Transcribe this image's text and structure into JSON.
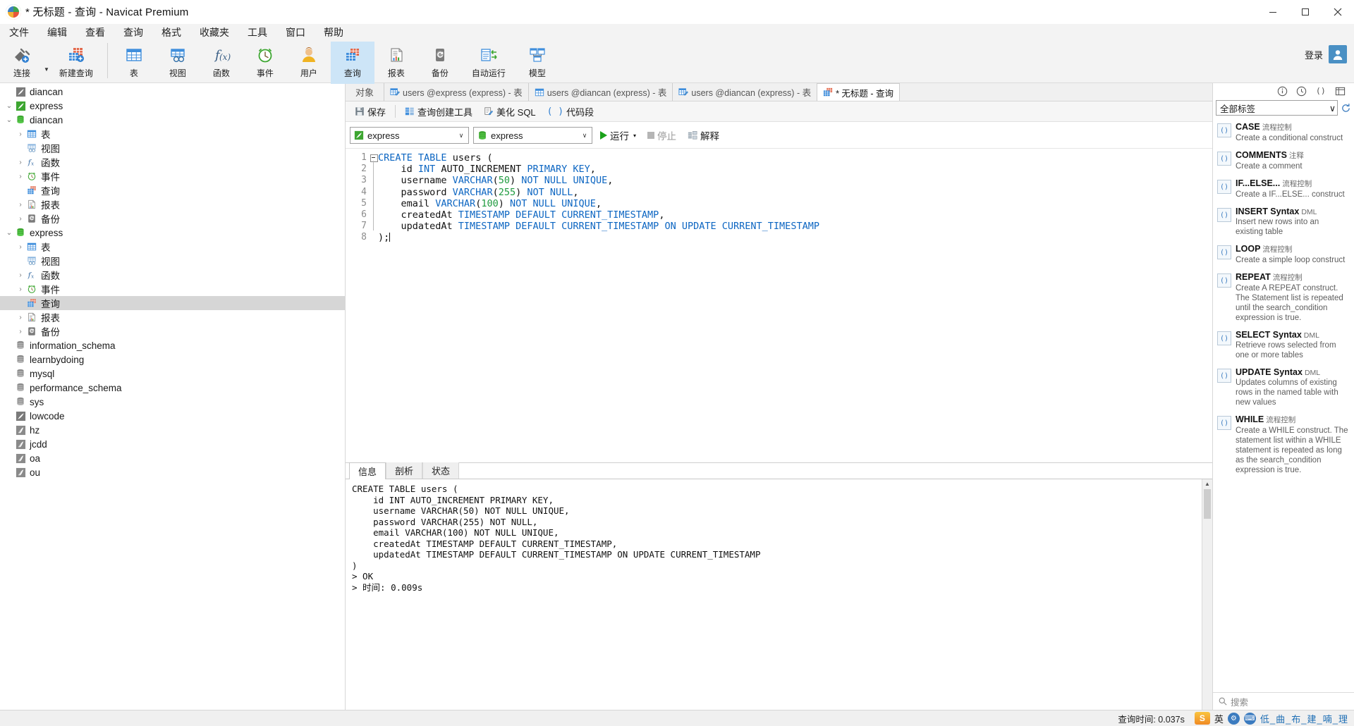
{
  "window": {
    "title": "* 无标题 - 查询 - Navicat Premium",
    "controls": {
      "minimize": "minimize-icon",
      "maximize": "maximize-icon",
      "close": "close-icon"
    }
  },
  "menubar": {
    "items": [
      {
        "label": "文件",
        "name": "menu-file"
      },
      {
        "label": "编辑",
        "name": "menu-edit"
      },
      {
        "label": "查看",
        "name": "menu-view"
      },
      {
        "label": "查询",
        "name": "menu-query"
      },
      {
        "label": "格式",
        "name": "menu-format"
      },
      {
        "label": "收藏夹",
        "name": "menu-favorites"
      },
      {
        "label": "工具",
        "name": "menu-tools"
      },
      {
        "label": "窗口",
        "name": "menu-window"
      },
      {
        "label": "帮助",
        "name": "menu-help"
      }
    ]
  },
  "ribbon": {
    "items": [
      {
        "label": "连接",
        "icon": "connection-icon"
      },
      {
        "label": "新建查询",
        "icon": "new-query-icon"
      },
      {
        "label": "表",
        "icon": "table-icon"
      },
      {
        "label": "视图",
        "icon": "view-icon"
      },
      {
        "label": "函数",
        "icon": "function-icon"
      },
      {
        "label": "事件",
        "icon": "event-clock-icon"
      },
      {
        "label": "用户",
        "icon": "user-icon"
      },
      {
        "label": "查询",
        "icon": "query-icon"
      },
      {
        "label": "报表",
        "icon": "report-icon"
      },
      {
        "label": "备份",
        "icon": "backup-icon"
      },
      {
        "label": "自动运行",
        "icon": "automation-icon"
      },
      {
        "label": "模型",
        "icon": "model-icon"
      }
    ],
    "active_index": 7,
    "login_label": "登录"
  },
  "sidebar": {
    "nodes": [
      {
        "label": "diancan",
        "depth": 0,
        "icon": "connection-gray-icon",
        "arrow": "",
        "selected": false
      },
      {
        "label": "express",
        "depth": 0,
        "icon": "connection-green-icon",
        "arrow": "expanded",
        "selected": false
      },
      {
        "label": "diancan",
        "depth": 1,
        "icon": "database-icon",
        "arrow": "expanded",
        "selected": false
      },
      {
        "label": "表",
        "depth": 2,
        "icon": "table-icon",
        "arrow": "collapsed",
        "selected": false
      },
      {
        "label": "视图",
        "depth": 2,
        "icon": "view-icon",
        "arrow": "",
        "selected": false
      },
      {
        "label": "函数",
        "depth": 2,
        "icon": "function-icon",
        "arrow": "collapsed",
        "selected": false
      },
      {
        "label": "事件",
        "depth": 2,
        "icon": "event-clock-icon",
        "arrow": "collapsed",
        "selected": false
      },
      {
        "label": "查询",
        "depth": 2,
        "icon": "query-icon",
        "arrow": "",
        "selected": false
      },
      {
        "label": "报表",
        "depth": 2,
        "icon": "report-icon",
        "arrow": "collapsed",
        "selected": false
      },
      {
        "label": "备份",
        "depth": 2,
        "icon": "backup-icon",
        "arrow": "collapsed",
        "selected": false
      },
      {
        "label": "express",
        "depth": 1,
        "icon": "database-icon",
        "arrow": "expanded",
        "selected": false
      },
      {
        "label": "表",
        "depth": 2,
        "icon": "table-icon",
        "arrow": "collapsed",
        "selected": false
      },
      {
        "label": "视图",
        "depth": 2,
        "icon": "view-icon",
        "arrow": "",
        "selected": false
      },
      {
        "label": "函数",
        "depth": 2,
        "icon": "function-icon",
        "arrow": "collapsed",
        "selected": false
      },
      {
        "label": "事件",
        "depth": 2,
        "icon": "event-clock-icon",
        "arrow": "collapsed",
        "selected": false
      },
      {
        "label": "查询",
        "depth": 2,
        "icon": "query-icon",
        "arrow": "",
        "selected": true
      },
      {
        "label": "报表",
        "depth": 2,
        "icon": "report-icon",
        "arrow": "collapsed",
        "selected": false
      },
      {
        "label": "备份",
        "depth": 2,
        "icon": "backup-icon",
        "arrow": "collapsed",
        "selected": false
      },
      {
        "label": "information_schema",
        "depth": 1,
        "icon": "database-gray-icon",
        "arrow": "",
        "selected": false
      },
      {
        "label": "learnbydoing",
        "depth": 1,
        "icon": "database-gray-icon",
        "arrow": "",
        "selected": false
      },
      {
        "label": "mysql",
        "depth": 1,
        "icon": "database-gray-icon",
        "arrow": "",
        "selected": false
      },
      {
        "label": "performance_schema",
        "depth": 1,
        "icon": "database-gray-icon",
        "arrow": "",
        "selected": false
      },
      {
        "label": "sys",
        "depth": 1,
        "icon": "database-gray-icon",
        "arrow": "",
        "selected": false
      },
      {
        "label": "lowcode",
        "depth": 0,
        "icon": "connection-gray-icon",
        "arrow": "",
        "selected": false
      },
      {
        "label": "hz",
        "depth": 0,
        "icon": "connection-sqlserver-icon",
        "arrow": "",
        "selected": false
      },
      {
        "label": "jcdd",
        "depth": 0,
        "icon": "connection-sqlserver-icon",
        "arrow": "",
        "selected": false
      },
      {
        "label": "oa",
        "depth": 0,
        "icon": "connection-sqlserver-icon",
        "arrow": "",
        "selected": false
      },
      {
        "label": "ou",
        "depth": 0,
        "icon": "connection-sqlserver-icon",
        "arrow": "",
        "selected": false
      }
    ]
  },
  "object_bar": {
    "label": "对象",
    "tabs": [
      {
        "label": "users @express (express) - 表",
        "icon": "table-edit-icon",
        "active": false
      },
      {
        "label": "users @diancan (express) - 表",
        "icon": "table-grid-icon",
        "active": false
      },
      {
        "label": "users @diancan (express) - 表",
        "icon": "table-edit-icon",
        "active": false
      },
      {
        "label": "* 无标题 - 查询",
        "icon": "query-icon",
        "active": true
      }
    ]
  },
  "query_toolbar": {
    "buttons": [
      {
        "label": "保存",
        "icon": "save-icon"
      },
      {
        "label": "查询创建工具",
        "icon": "query-builder-icon"
      },
      {
        "label": "美化 SQL",
        "icon": "beautify-icon"
      },
      {
        "label": "代码段",
        "icon": "code-snippet-icon"
      }
    ]
  },
  "connection_bar": {
    "connection": {
      "value": "express",
      "icon": "connection-green-icon"
    },
    "database": {
      "value": "express",
      "icon": "database-icon"
    },
    "run_label": "运行",
    "stop_label": "停止",
    "explain_label": "解释"
  },
  "editor": {
    "line_numbers": [
      "1",
      "2",
      "3",
      "4",
      "5",
      "6",
      "7",
      "8"
    ],
    "sql_lines": [
      "CREATE TABLE users (",
      "    id INT AUTO_INCREMENT PRIMARY KEY,",
      "    username VARCHAR(50) NOT NULL UNIQUE,",
      "    password VARCHAR(255) NOT NULL,",
      "    email VARCHAR(100) NOT NULL UNIQUE,",
      "    createdAt TIMESTAMP DEFAULT CURRENT_TIMESTAMP,",
      "    updatedAt TIMESTAMP DEFAULT CURRENT_TIMESTAMP ON UPDATE CURRENT_TIMESTAMP",
      ");"
    ]
  },
  "results": {
    "tabs": [
      {
        "label": "信息",
        "active": true
      },
      {
        "label": "剖析",
        "active": false
      },
      {
        "label": "状态",
        "active": false
      }
    ],
    "output": "CREATE TABLE users (\n    id INT AUTO_INCREMENT PRIMARY KEY,\n    username VARCHAR(50) NOT NULL UNIQUE,\n    password VARCHAR(255) NOT NULL,\n    email VARCHAR(100) NOT NULL UNIQUE,\n    createdAt TIMESTAMP DEFAULT CURRENT_TIMESTAMP,\n    updatedAt TIMESTAMP DEFAULT CURRENT_TIMESTAMP ON UPDATE CURRENT_TIMESTAMP\n)\n> OK\n> 时间: 0.009s"
  },
  "right_panel": {
    "filter": {
      "value": "全部标签"
    },
    "search_placeholder": "搜索",
    "snippets": [
      {
        "title": "CASE",
        "tag": "流程控制",
        "desc": "Create a conditional construct"
      },
      {
        "title": "COMMENTS",
        "tag": "注释",
        "desc": "Create a comment"
      },
      {
        "title": "IF...ELSE...",
        "tag": "流程控制",
        "desc": "Create a IF...ELSE... construct"
      },
      {
        "title": "INSERT Syntax",
        "tag": "DML",
        "desc": "Insert new rows into an existing table"
      },
      {
        "title": "LOOP",
        "tag": "流程控制",
        "desc": "Create a simple loop construct"
      },
      {
        "title": "REPEAT",
        "tag": "流程控制",
        "desc": "Create A REPEAT construct. The Statement list is repeated until the search_condition expression is true."
      },
      {
        "title": "SELECT Syntax",
        "tag": "DML",
        "desc": "Retrieve rows selected from one or more tables"
      },
      {
        "title": "UPDATE Syntax",
        "tag": "DML",
        "desc": "Updates columns of existing rows in the named table with new values"
      },
      {
        "title": "WHILE",
        "tag": "流程控制",
        "desc": "Create a WHILE construct. The statement list within a WHILE statement is repeated as long as the search_condition expression is true."
      }
    ]
  },
  "statusbar": {
    "query_time": "查询时间: 0.037s",
    "ime_badge": "S",
    "ime_label": "英",
    "watermark": "低_曲_布_建_喃_理"
  }
}
